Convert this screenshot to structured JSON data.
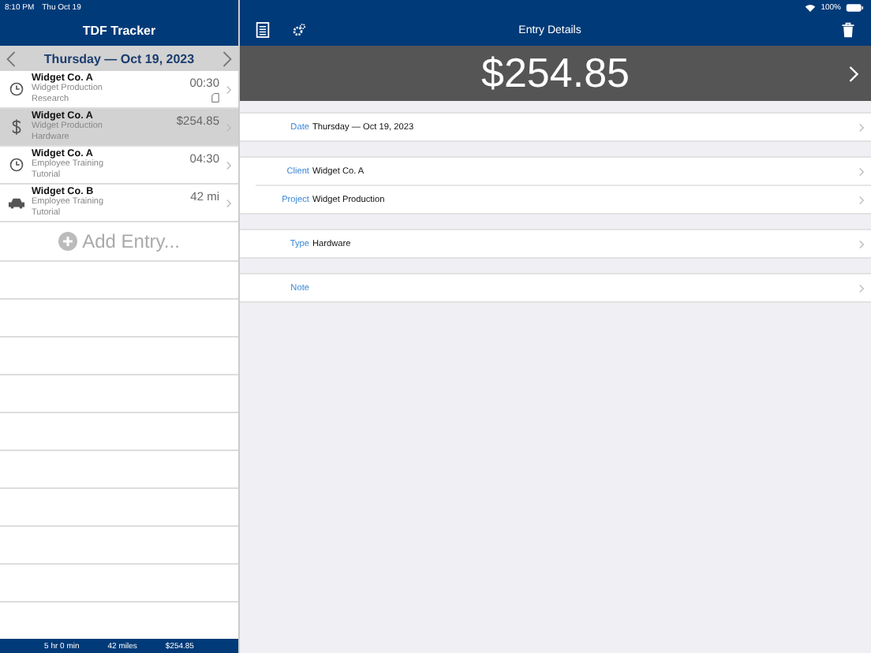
{
  "status_bar": {
    "time": "8:10 PM",
    "date": "Thu Oct 19",
    "battery": "100%"
  },
  "sidebar": {
    "title": "TDF Tracker",
    "date": "Thursday — Oct 19, 2023",
    "entries": [
      {
        "kind": "time",
        "client": "Widget Co. A",
        "project": "Widget Production",
        "type": "Research",
        "value": "00:30",
        "attachment": true,
        "selected": false
      },
      {
        "kind": "expense",
        "client": "Widget Co. A",
        "project": "Widget Production",
        "type": "Hardware",
        "value": "$254.85",
        "attachment": false,
        "selected": true
      },
      {
        "kind": "time",
        "client": "Widget Co. A",
        "project": "Employee Training",
        "type": "Tutorial",
        "value": "04:30",
        "attachment": false,
        "selected": false
      },
      {
        "kind": "mileage",
        "client": "Widget Co. B",
        "project": "Employee Training",
        "type": "Tutorial",
        "value": "42 mi",
        "attachment": false,
        "selected": false
      }
    ],
    "add_label": "Add Entry...",
    "totals": [
      "5 hr 0 min",
      "42 miles",
      "$254.85"
    ]
  },
  "detail": {
    "title": "Entry Details",
    "amount": "$254.85",
    "groups": [
      [
        {
          "label": "Date",
          "value": "Thursday — Oct 19, 2023"
        }
      ],
      [
        {
          "label": "Client",
          "value": "Widget Co. A"
        },
        {
          "label": "Project",
          "value": "Widget Production"
        }
      ],
      [
        {
          "label": "Type",
          "value": "Hardware"
        }
      ],
      [
        {
          "label": "Note"
        }
      ]
    ]
  }
}
